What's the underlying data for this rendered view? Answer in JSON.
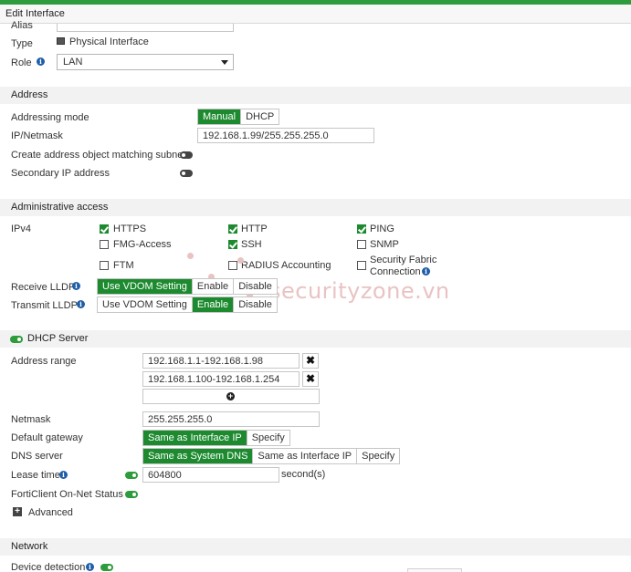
{
  "window": {
    "title": "Edit Interface"
  },
  "interface": {
    "alias_label": "Alias",
    "type_label": "Type",
    "type_value": "Physical Interface",
    "role_label": "Role",
    "role_value": "LAN"
  },
  "address": {
    "section": "Address",
    "mode_label": "Addressing mode",
    "mode_options": [
      "Manual",
      "DHCP"
    ],
    "mode_selected": "Manual",
    "ip_label": "IP/Netmask",
    "ip_value": "192.168.1.99/255.255.255.0",
    "create_obj_label": "Create address object matching subnet",
    "create_obj_enabled": false,
    "secondary_label": "Secondary IP address",
    "secondary_enabled": false
  },
  "admin": {
    "section": "Administrative access",
    "ipv4_label": "IPv4",
    "protocols": [
      {
        "label": "HTTPS",
        "checked": true
      },
      {
        "label": "HTTP",
        "checked": true
      },
      {
        "label": "PING",
        "checked": true
      },
      {
        "label": "FMG-Access",
        "checked": false
      },
      {
        "label": "SSH",
        "checked": true
      },
      {
        "label": "SNMP",
        "checked": false
      },
      {
        "label": "FTM",
        "checked": false
      },
      {
        "label": "RADIUS Accounting",
        "checked": false
      },
      {
        "label": "Security Fabric",
        "label2": "Connection",
        "checked": false
      }
    ],
    "receive_lldp_label": "Receive LLDP",
    "receive_lldp_options": [
      "Use VDOM Setting",
      "Enable",
      "Disable"
    ],
    "receive_lldp_selected": "Use VDOM Setting",
    "transmit_lldp_label": "Transmit LLDP",
    "transmit_lldp_options": [
      "Use VDOM Setting",
      "Enable",
      "Disable"
    ],
    "transmit_lldp_selected": "Enable"
  },
  "dhcp": {
    "section": "DHCP Server",
    "enabled": true,
    "range_label": "Address range",
    "ranges": [
      "192.168.1.1-192.168.1.98",
      "192.168.1.100-192.168.1.254"
    ],
    "netmask_label": "Netmask",
    "netmask_value": "255.255.255.0",
    "gateway_label": "Default gateway",
    "gateway_options": [
      "Same as Interface IP",
      "Specify"
    ],
    "gateway_selected": "Same as Interface IP",
    "dns_label": "DNS server",
    "dns_options": [
      "Same as System DNS",
      "Same as Interface IP",
      "Specify"
    ],
    "dns_selected": "Same as System DNS",
    "lease_label": "Lease time",
    "lease_enabled": true,
    "lease_value": "604800",
    "lease_unit": "second(s)",
    "forticlient_label": "FortiClient On-Net Status",
    "forticlient_enabled": true,
    "advanced_label": "Advanced"
  },
  "network": {
    "section": "Network",
    "device_detection_label": "Device detection",
    "device_detection_enabled": true
  },
  "watermark": "securityzone.vn",
  "colors": {
    "accent": "#1d8a2f",
    "topbar": "#2e9c3c",
    "info": "#1f5ea8"
  }
}
